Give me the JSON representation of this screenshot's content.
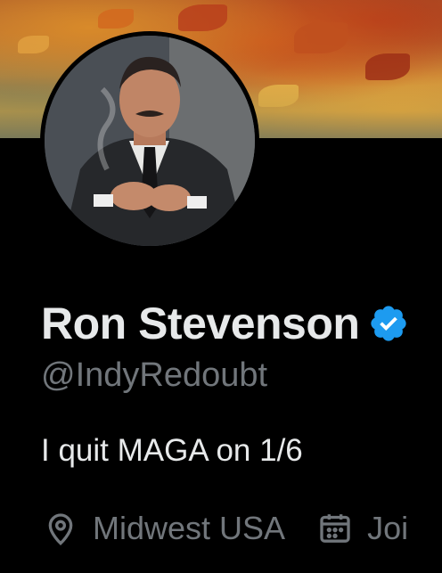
{
  "profile": {
    "display_name": "Ron Stevenson",
    "handle": "@IndyRedoubt",
    "bio": "I quit MAGA on 1/6",
    "verified": true,
    "location": "Midwest USA",
    "joined_label": "Joi"
  },
  "icons": {
    "verified": "verified-badge-icon",
    "location": "location-pin-icon",
    "calendar": "calendar-icon"
  },
  "colors": {
    "background": "#000000",
    "primary_text": "#e7e9ea",
    "secondary_text": "#71767b",
    "verified_blue": "#1d9bf0"
  }
}
